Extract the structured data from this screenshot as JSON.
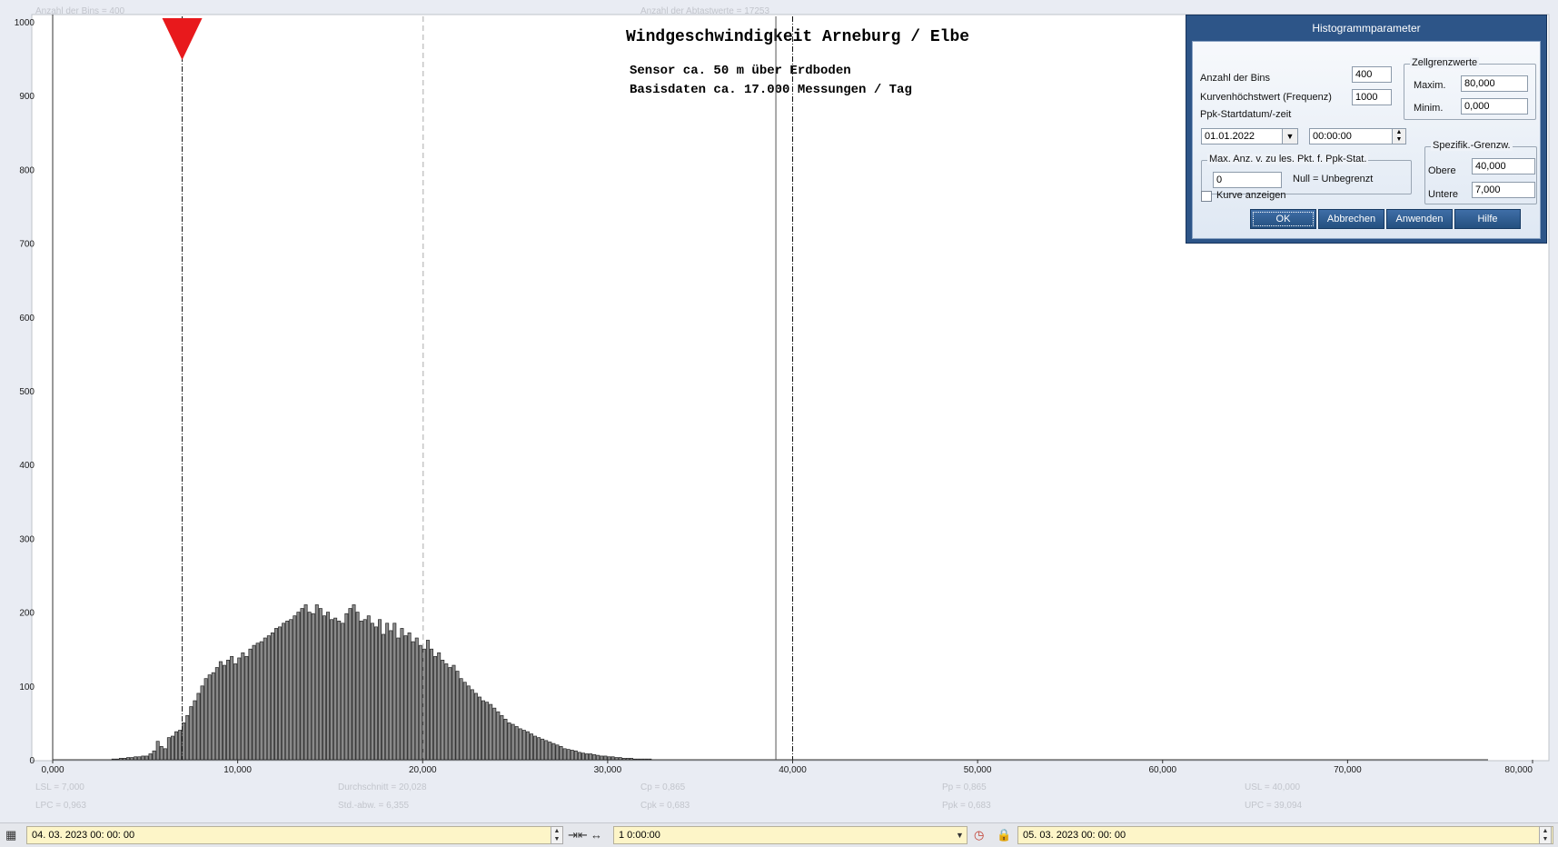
{
  "header": {
    "bins_info": "Anzahl der Bins =  400",
    "samples_info": "Anzahl der Abtastwerte = 17253"
  },
  "chart_data": {
    "type": "bar",
    "title": "Windgeschwindigkeit  Arneburg / Elbe",
    "subtitle_lines": [
      "Sensor ca. 50 m über Erdboden",
      "Basisdaten ca. 17.000 Messungen / Tag"
    ],
    "xlabel": "",
    "ylabel": "",
    "xlim": [
      0,
      80
    ],
    "ylim": [
      0,
      1000
    ],
    "x_ticks": [
      "0,000",
      "10,000",
      "20,000",
      "30,000",
      "40,000",
      "50,000",
      "60,000",
      "70,000",
      "80,000"
    ],
    "y_ticks": [
      "0",
      "100",
      "200",
      "300",
      "400",
      "500",
      "600",
      "700",
      "800",
      "900",
      "1000"
    ],
    "bin_width": 0.2,
    "bin_start": 3.2,
    "values": [
      1,
      1,
      2,
      2,
      3,
      3,
      4,
      4,
      5,
      5,
      8,
      12,
      25,
      18,
      15,
      30,
      32,
      38,
      40,
      50,
      60,
      72,
      80,
      90,
      100,
      110,
      115,
      118,
      125,
      133,
      128,
      135,
      140,
      130,
      138,
      145,
      140,
      150,
      155,
      158,
      160,
      165,
      168,
      172,
      178,
      180,
      185,
      188,
      190,
      195,
      200,
      205,
      210,
      200,
      198,
      210,
      205,
      195,
      200,
      190,
      192,
      188,
      185,
      198,
      205,
      210,
      200,
      188,
      190,
      195,
      185,
      180,
      190,
      170,
      185,
      175,
      185,
      165,
      178,
      168,
      172,
      160,
      165,
      155,
      150,
      162,
      150,
      140,
      145,
      135,
      130,
      125,
      128,
      120,
      110,
      105,
      100,
      95,
      90,
      85,
      80,
      78,
      75,
      70,
      65,
      60,
      55,
      50,
      48,
      45,
      42,
      40,
      38,
      35,
      32,
      30,
      28,
      26,
      24,
      22,
      20,
      18,
      15,
      14,
      13,
      12,
      10,
      9,
      8,
      8,
      7,
      6,
      5,
      5,
      4,
      4,
      3,
      3,
      2,
      2,
      2,
      1,
      1,
      1,
      1,
      1
    ],
    "reference_lines": [
      {
        "name": "LSL",
        "x": 7.0,
        "style": "dashdot"
      },
      {
        "name": "mean",
        "x": 20.028,
        "style": "dashed"
      },
      {
        "name": "UPC",
        "x": 39.094,
        "style": "solid"
      },
      {
        "name": "USL",
        "x": 40.0,
        "style": "dashdot"
      }
    ],
    "marker": {
      "x": 7.0,
      "color": "#e8191c"
    },
    "grid": false
  },
  "stats": {
    "lsl": "LSL = 7,000",
    "lpc": "LPC = 0,963",
    "mean": "Durchschnitt  = 20,028",
    "std": "Std.-abw. = 6,355",
    "cp": "Cp  = 0,865",
    "cpk": "Cpk = 0,683",
    "pp": "Pp  = 0,865",
    "ppk": "Ppk = 0,683",
    "usl": "USL = 40,000",
    "upc": "UPC = 39,094"
  },
  "dialog": {
    "title": "Histogrammparameter",
    "bins_label": "Anzahl der Bins",
    "bins_value": "400",
    "peak_label": "Kurvenhöchstwert (Frequenz)",
    "peak_value": "1000",
    "ppk_label": "Ppk-Startdatum/-zeit",
    "date_value": "01.01.2022",
    "time_value": "00:00:00",
    "cell_group": "Zellgrenzwerte",
    "max_label": "Maxim.",
    "max_value": "80,000",
    "min_label": "Minim.",
    "min_value": "0,000",
    "maxpts_group": "Max. Anz. v. zu les. Pkt. f. Ppk-Stat.",
    "maxpts_value": "0",
    "null_note": "Null = Unbegrenzt",
    "spec_group": "Spezifik.-Grenzw.",
    "upper_label": "Obere",
    "upper_value": "40,000",
    "lower_label": "Untere",
    "lower_value": "7,000",
    "curve_label": "Kurve anzeigen",
    "ok": "OK",
    "cancel": "Abbrechen",
    "apply": "Anwenden",
    "help": "Hilfe"
  },
  "toolbar": {
    "start": "04. 03. 2023   00: 00: 00",
    "interval": "1  0:00:00",
    "end": "05. 03. 2023   00: 00: 00"
  }
}
